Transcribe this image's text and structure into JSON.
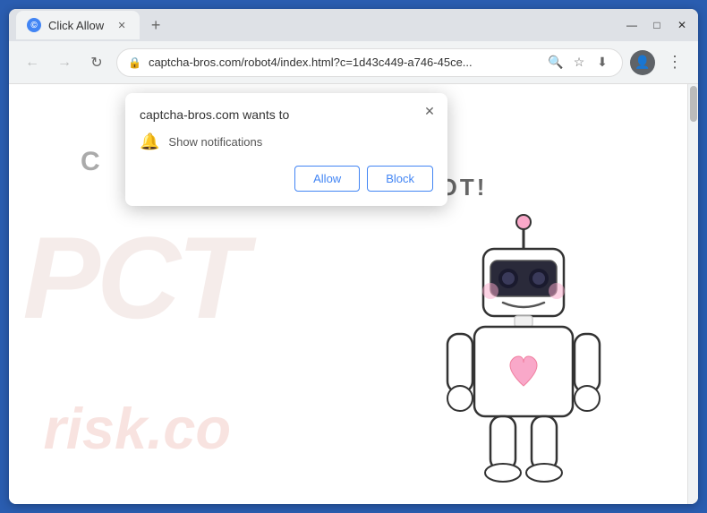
{
  "browser": {
    "tab": {
      "title": "Click Allow",
      "icon": "©"
    },
    "address_bar": {
      "url": "captcha-bros.com/robot4/index.html?c=1d43c449-a746-45ce...",
      "lock_icon": "🔒"
    },
    "window_controls": {
      "minimize": "—",
      "maximize": "□",
      "close": "✕"
    },
    "nav": {
      "back": "←",
      "forward": "→",
      "reload": "↻",
      "new_tab": "+"
    }
  },
  "notification_dialog": {
    "title": "captcha-bros.com wants to",
    "notification_item": "Show notifications",
    "close_icon": "✕",
    "allow_button": "Allow",
    "block_button": "Block"
  },
  "website": {
    "captcha_header": "C",
    "captcha_text": "ARE NOT A ROBOT!",
    "watermark_pct": "PCT",
    "watermark_risk": "risk.co"
  },
  "colors": {
    "accent_blue": "#4285f4",
    "bg_blue": "#2a5db0",
    "watermark_pink": "rgba(220,170,160,0.2)",
    "watermark_red": "rgba(210,80,60,0.18)"
  }
}
